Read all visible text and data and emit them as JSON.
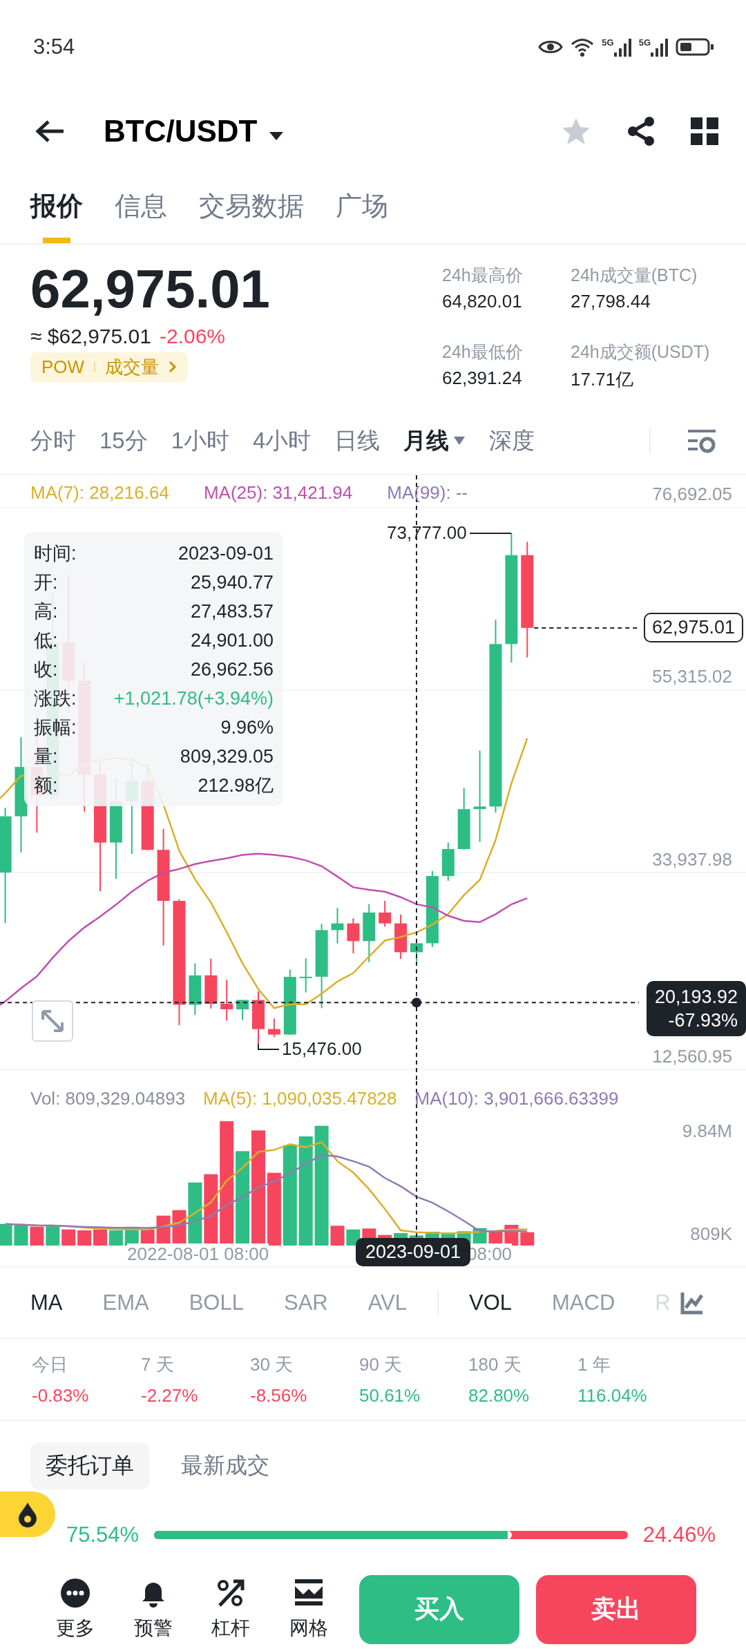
{
  "status_bar": {
    "time": "3:54",
    "network_1": "5G",
    "network_2": "5G"
  },
  "header": {
    "title": "BTC/USDT",
    "favorite": false
  },
  "tabs": [
    {
      "label": "报价",
      "selected": true
    },
    {
      "label": "信息",
      "selected": false
    },
    {
      "label": "交易数据",
      "selected": false
    },
    {
      "label": "广场",
      "selected": false
    }
  ],
  "price": {
    "last": "62,975.01",
    "approx": "≈ $62,975.01",
    "change": "-2.06%",
    "tags": [
      "POW",
      "成交量"
    ]
  },
  "stats": [
    {
      "label": "24h最高价",
      "value": "64,820.01"
    },
    {
      "label": "24h成交量(BTC)",
      "value": "27,798.44"
    },
    {
      "label": "24h最低价",
      "value": "62,391.24"
    },
    {
      "label": "24h成交额(USDT)",
      "value": "17.71亿"
    }
  ],
  "intervals": [
    {
      "label": "分时",
      "selected": false,
      "has_menu": false
    },
    {
      "label": "15分",
      "selected": false,
      "has_menu": false
    },
    {
      "label": "1小时",
      "selected": false,
      "has_menu": false
    },
    {
      "label": "4小时",
      "selected": false,
      "has_menu": false
    },
    {
      "label": "日线",
      "selected": false,
      "has_menu": false
    },
    {
      "label": "月线",
      "selected": true,
      "has_menu": true
    },
    {
      "label": "深度",
      "selected": false,
      "has_menu": false
    }
  ],
  "chart": {
    "ma_legend": [
      {
        "label": "MA(7): 28,216.64",
        "color": "#d8b02a"
      },
      {
        "label": "MA(25): 31,421.94",
        "color": "#c04fae"
      },
      {
        "label": "MA(99): --",
        "color": "#8e7bb5"
      }
    ],
    "y_axis": [
      "76,692.05",
      "55,315.02",
      "33,937.98",
      "12,560.95"
    ],
    "high_label": "73,777.00",
    "low_label": "15,476.00",
    "last_price_tag": "62,975.01",
    "crosshair": {
      "price": "20,193.92",
      "change": "-67.93%",
      "time": "2023-09-01"
    },
    "tooltip": [
      {
        "label": "时间:",
        "value": "2023-09-01",
        "color": "#1e2329"
      },
      {
        "label": "开:",
        "value": "25,940.77",
        "color": "#1e2329"
      },
      {
        "label": "高:",
        "value": "27,483.57",
        "color": "#1e2329"
      },
      {
        "label": "低:",
        "value": "24,901.00",
        "color": "#1e2329"
      },
      {
        "label": "收:",
        "value": "26,962.56",
        "color": "#1e2329"
      },
      {
        "label": "涨跌:",
        "value": "+1,021.78(+3.94%)",
        "color": "#2ebd85"
      },
      {
        "label": "振幅:",
        "value": "9.96%",
        "color": "#1e2329"
      },
      {
        "label": "量:",
        "value": "809,329.05",
        "color": "#1e2329"
      },
      {
        "label": "额:",
        "value": "212.98亿",
        "color": "#1e2329"
      }
    ]
  },
  "volume": {
    "legend": [
      {
        "label": "Vol: 809,329.04893",
        "color": "#8a8f99"
      },
      {
        "label": "MA(5): 1,090,035.47828",
        "color": "#d8b02a"
      },
      {
        "label": "MA(10): 3,901,666.63399",
        "color": "#8e7bb5"
      }
    ],
    "y_axis": [
      "9.84M",
      "809K"
    ],
    "x_axis": [
      "2022-08-01 08:00",
      "08:00"
    ]
  },
  "main_indicators": [
    {
      "label": "MA",
      "selected": true
    },
    {
      "label": "EMA",
      "selected": false
    },
    {
      "label": "BOLL",
      "selected": false
    },
    {
      "label": "SAR",
      "selected": false
    },
    {
      "label": "AVL",
      "selected": false
    }
  ],
  "sub_indicators": [
    {
      "label": "VOL",
      "selected": true
    },
    {
      "label": "MACD",
      "selected": false
    },
    {
      "label": "R",
      "selected": false
    }
  ],
  "performance": [
    {
      "period": "今日",
      "value": "-0.83%",
      "color": "#f6465d"
    },
    {
      "period": "7 天",
      "value": "-2.27%",
      "color": "#f6465d"
    },
    {
      "period": "30 天",
      "value": "-8.56%",
      "color": "#f6465d"
    },
    {
      "period": "90 天",
      "value": "50.61%",
      "color": "#2ebd85"
    },
    {
      "period": "180 天",
      "value": "82.80%",
      "color": "#2ebd85"
    },
    {
      "period": "1 年",
      "value": "116.04%",
      "color": "#2ebd85"
    }
  ],
  "order_tabs": [
    {
      "label": "委托订单",
      "selected": true
    },
    {
      "label": "最新成交",
      "selected": false
    }
  ],
  "ratio": {
    "buy": "75.54%",
    "sell": "24.46%",
    "level": 0.7554
  },
  "nav": [
    {
      "label": "更多",
      "kind": "more"
    },
    {
      "label": "预警",
      "kind": "bell"
    },
    {
      "label": "杠杆",
      "kind": "percent"
    },
    {
      "label": "网格",
      "kind": "grid"
    }
  ],
  "actions": [
    {
      "label": "买入",
      "kind": "buy"
    },
    {
      "label": "卖出",
      "kind": "sell"
    }
  ]
}
